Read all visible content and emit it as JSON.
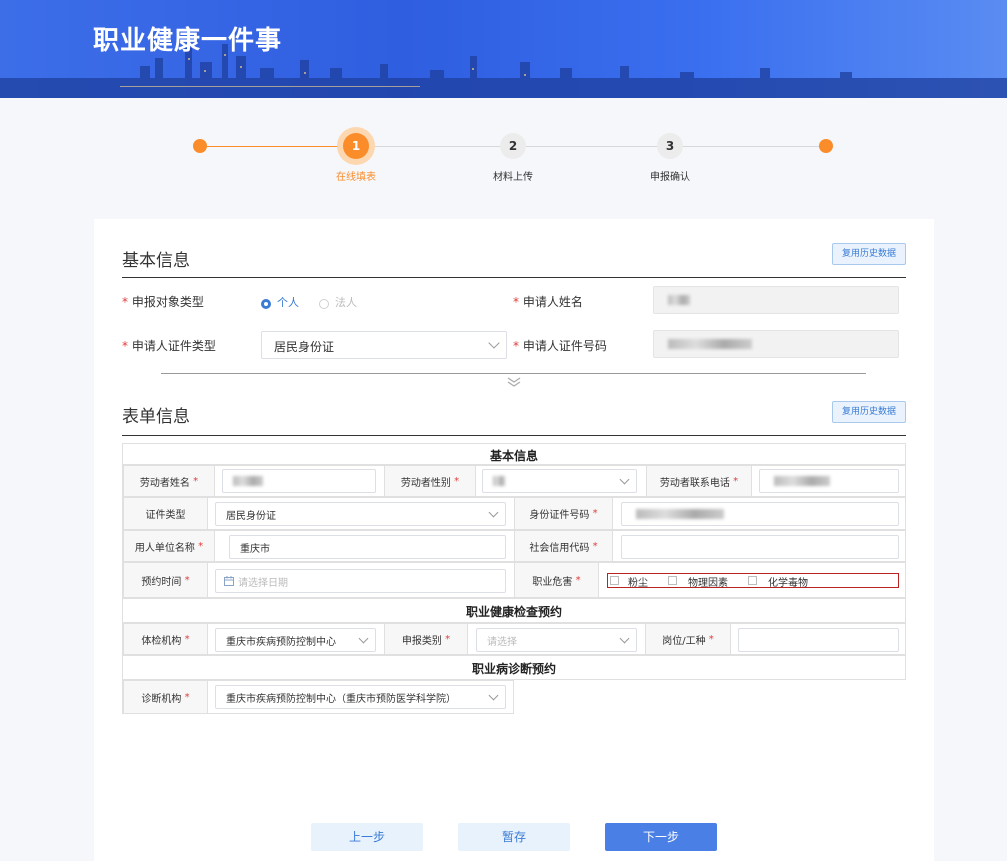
{
  "app_title": "职业健康一件事",
  "steps": [
    {
      "number": "1",
      "label": "在线填表"
    },
    {
      "number": "2",
      "label": "材料上传"
    },
    {
      "number": "3",
      "label": "申报确认"
    }
  ],
  "basic": {
    "title": "基本信息",
    "history_button": "复用历史数据",
    "applicant_type_label": "申报对象类型",
    "applicant_type_options": [
      "个人",
      "法人"
    ],
    "applicant_name_label": "申请人姓名",
    "id_type_label": "申请人证件类型",
    "id_type_value": "居民身份证",
    "id_number_label": "申请人证件号码"
  },
  "form": {
    "title": "表单信息",
    "history_button": "复用历史数据",
    "section1_title": "基本信息",
    "worker_name_label": "劳动者姓名",
    "worker_gender_label": "劳动者性别",
    "worker_phone_label": "劳动者联系电话",
    "cert_type_label": "证件类型",
    "cert_type_value": "居民身份证",
    "id_number_label": "身份证件号码",
    "employer_label": "用人单位名称",
    "employer_value": "重庆市",
    "credit_code_label": "社会信用代码",
    "appointment_label": "预约时间",
    "appointment_placeholder": "请选择日期",
    "hazard_label": "职业危害",
    "hazard_options": [
      "粉尘",
      "物理因素",
      "化学毒物"
    ],
    "section2_title": "职业健康检查预约",
    "exam_org_label": "体检机构",
    "exam_org_value": "重庆市疾病预防控制中心",
    "report_type_label": "申报类别",
    "report_type_placeholder": "请选择",
    "position_label": "岗位/工种",
    "section3_title": "职业病诊断预约",
    "diag_org_label": "诊断机构",
    "diag_org_value": "重庆市疾病预防控制中心（重庆市预防医学科学院）"
  },
  "required_mark": "*",
  "buttons": {
    "prev": "上一步",
    "save": "暂存",
    "next": "下一步"
  },
  "colors": {
    "accent": "#fa8c2a",
    "primary": "#4a7fe6",
    "banner": "#2f5ee0",
    "required": "#e23b3b"
  }
}
